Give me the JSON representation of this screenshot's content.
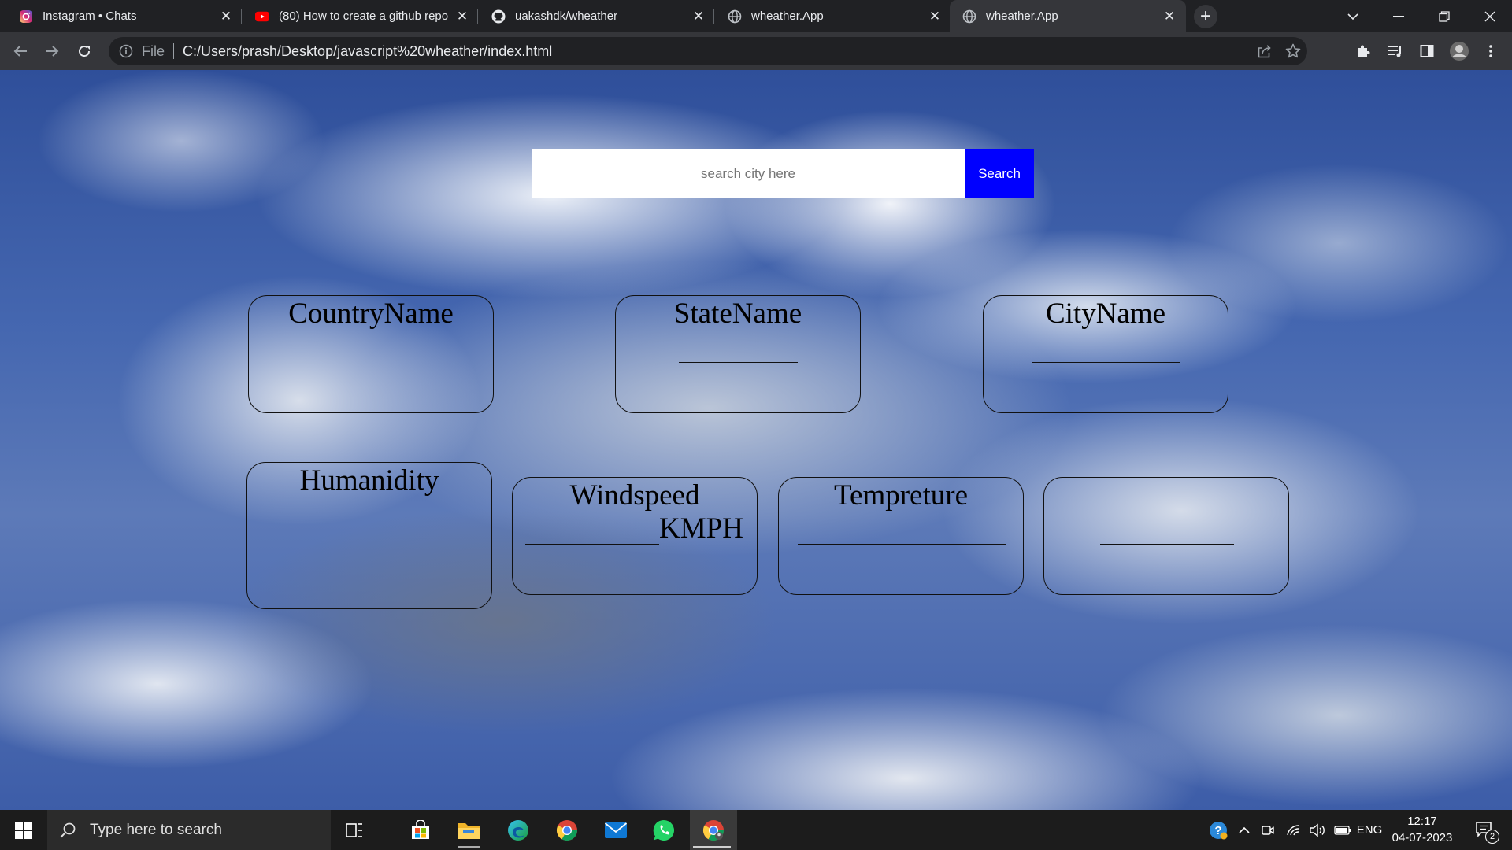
{
  "browser": {
    "tabs": [
      {
        "title": "Instagram • Chats",
        "favicon": "instagram-icon"
      },
      {
        "title": "(80) How to create a github repo",
        "favicon": "youtube-icon"
      },
      {
        "title": "uakashdk/wheather",
        "favicon": "github-icon"
      },
      {
        "title": "wheather.App",
        "favicon": "globe-icon"
      },
      {
        "title": "wheather.App",
        "favicon": "globe-icon",
        "active": true
      }
    ],
    "address": {
      "scheme_label": "File",
      "url": "C:/Users/prash/Desktop/javascript%20wheather/index.html"
    }
  },
  "page": {
    "search": {
      "placeholder": "search city here",
      "value": "",
      "button_label": "Search",
      "button_color": "#0000ff"
    },
    "cards": {
      "country": {
        "title": "CountryName"
      },
      "state": {
        "title": "StateName"
      },
      "city": {
        "title": "CityName"
      },
      "humidity": {
        "title": "Humanidity"
      },
      "windspeed": {
        "title": "Windspeed",
        "unit": "KMPH"
      },
      "temperature": {
        "title": "Tempreture"
      },
      "extra": {
        "title": ""
      }
    }
  },
  "taskbar": {
    "search_placeholder": "Type here to search",
    "language": "ENG",
    "time": "12:17",
    "date": "04-07-2023",
    "notification_count": "2"
  }
}
